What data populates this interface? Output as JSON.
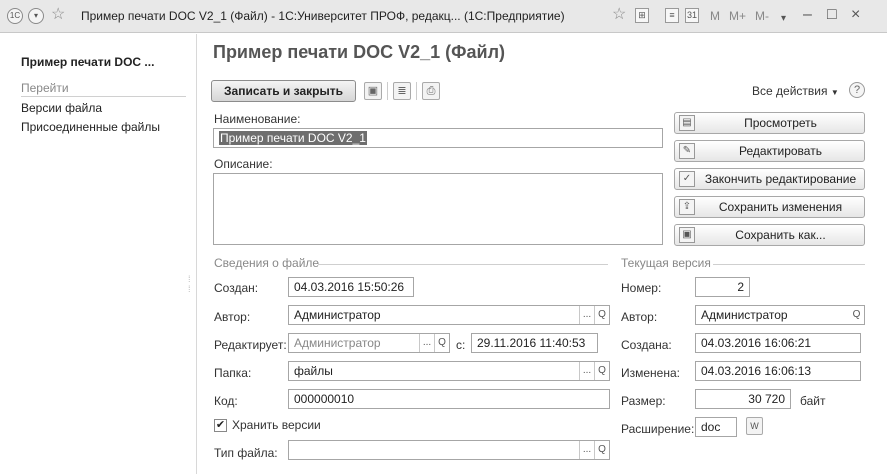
{
  "window": {
    "title": "Пример печати DOC V2_1 (Файл) - 1С:Университет ПРОФ, редакц... (1С:Предприятие)",
    "toolbar_m": "M",
    "toolbar_mplus": "M+",
    "toolbar_mminus": "M-"
  },
  "sidebar": {
    "title": "Пример печати DOC ...",
    "goto_label": "Перейти",
    "items": [
      {
        "label": "Версии файла"
      },
      {
        "label": "Присоединенные файлы"
      }
    ]
  },
  "form": {
    "title": "Пример печати DOC V2_1 (Файл)",
    "save_close_label": "Записать и закрыть",
    "all_actions_label": "Все действия",
    "help_label": "?",
    "name_label": "Наименование:",
    "name_value": "Пример печати DOC V2_1",
    "description_label": "Описание:",
    "description_value": ""
  },
  "actions": {
    "view": "Просмотреть",
    "edit": "Редактировать",
    "finish_edit": "Закончить редактирование",
    "save_changes": "Сохранить изменения",
    "save_as": "Сохранить как..."
  },
  "file_info": {
    "section_title": "Сведения о файле",
    "created_label": "Создан:",
    "created_value": "04.03.2016 15:50:26",
    "author_label": "Автор:",
    "author_value": "Администратор",
    "editing_label": "Редактирует:",
    "editing_value": "Администратор",
    "since_label": "с:",
    "since_value": "29.11.2016 11:40:53",
    "folder_label": "Папка:",
    "folder_value": "файлы",
    "code_label": "Код:",
    "code_value": "000000010",
    "keep_versions_label": "Хранить версии",
    "keep_versions_checked": true,
    "file_type_label": "Тип файла:",
    "file_type_value": ""
  },
  "current_version": {
    "section_title": "Текущая версия",
    "number_label": "Номер:",
    "number_value": "2",
    "author_label": "Автор:",
    "author_value": "Администратор",
    "created_label": "Создана:",
    "created_value": "04.03.2016 16:06:21",
    "changed_label": "Изменена:",
    "changed_value": "04.03.2016 16:06:13",
    "size_label": "Размер:",
    "size_value": "30 720",
    "size_unit": "байт",
    "extension_label": "Расширение:",
    "extension_value": "doc"
  },
  "glyphs": {
    "ellipsis": "...",
    "search": "Q",
    "dropdown": "▼"
  }
}
